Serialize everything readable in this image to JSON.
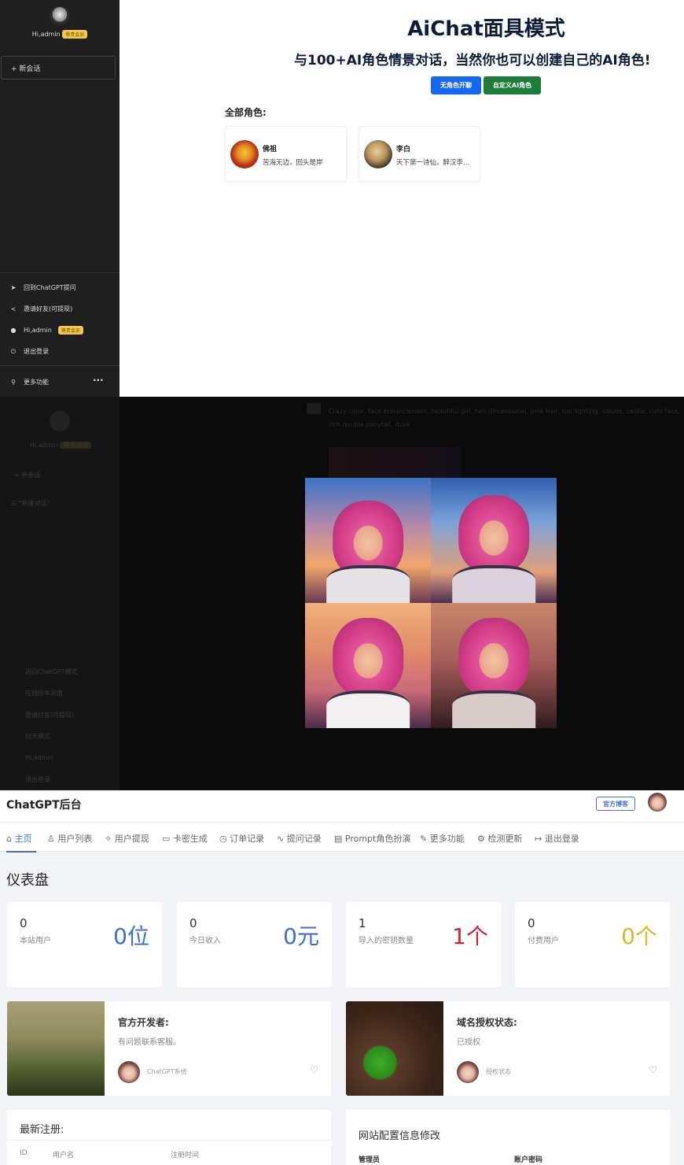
{
  "panel1": {
    "user": {
      "greeting": "Hi,admin",
      "badge": "尊贵会员"
    },
    "new_chat": "+ 新会话",
    "menu": [
      {
        "icon": "send-icon",
        "label": "回到ChatGPT提问"
      },
      {
        "icon": "share-icon",
        "label": "邀请好友(可提现)"
      },
      {
        "icon": "user-icon",
        "label": "Hi,admin",
        "badge": "尊贵会员"
      },
      {
        "icon": "power-icon",
        "label": "退出登录"
      }
    ],
    "more": {
      "label": "更多功能",
      "dots": "···"
    },
    "title": "AiChat面具模式",
    "subtitle": "与100+AI角色情景对话，当然你也可以创建自己的AI角色!",
    "btn_primary": "无角色开聊",
    "btn_custom": "自定义AI角色",
    "section_label": "全部角色:",
    "roles": [
      {
        "name": "佛祖",
        "desc": "苦海无边，回头是岸"
      },
      {
        "name": "李白",
        "desc": "天下第一诗仙，醉汉李..."
      }
    ],
    "colors": {
      "primary": "#1668f2",
      "green": "#1c7d3b",
      "sidebar": "#1f1f1f"
    }
  },
  "panel2": {
    "user": {
      "greeting": "Hi,admin",
      "badge": "尊贵会员"
    },
    "new_chat": "+ 新会话",
    "history": "\"新建对话\"",
    "prompt": "Crazy color, face enhancement, beautiful girl, two dimensional, pink hair, top lighting, clouds, castle, cute face, rich double ponytail, dusk",
    "menu": [
      "返回ChatGPT模式",
      "在线绘本充值",
      "邀请好友(可提现)",
      "扫天模式",
      "Hi,admin",
      "退出登录"
    ]
  },
  "panel3": {
    "brand": "ChatGPT后台",
    "blog": "官方博客",
    "nav": [
      "主页",
      "用户列表",
      "用户提现",
      "卡密生成",
      "订单记录",
      "提问记录",
      "Prompt角色扮演",
      "更多功能",
      "检测更新",
      "退出登录"
    ],
    "dashboard": "仪表盘",
    "stats": [
      {
        "value": "0",
        "label": "本站用户",
        "big": "0位",
        "color": "#3b6fd6"
      },
      {
        "value": "0",
        "label": "今日收入",
        "big": "0元",
        "color": "#3b6fd6"
      },
      {
        "value": "1",
        "label": "导入的密钥数量",
        "big": "1个",
        "color": "#c8292c"
      },
      {
        "value": "0",
        "label": "付费用户",
        "big": "0个",
        "color": "#e0b523"
      }
    ],
    "infos": [
      {
        "title": "官方开发者:",
        "sub": "有问题联系客服。",
        "small": "ChatGPT系统"
      },
      {
        "title": "域名授权状态:",
        "sub": "已授权",
        "small": "授权状态"
      }
    ],
    "recent": {
      "title": "最新注册:",
      "cols": [
        "ID",
        "用户名",
        "注册时间"
      ]
    },
    "config": {
      "title": "网站配置信息修改",
      "cols": [
        "管理员",
        "账户密码"
      ]
    }
  }
}
